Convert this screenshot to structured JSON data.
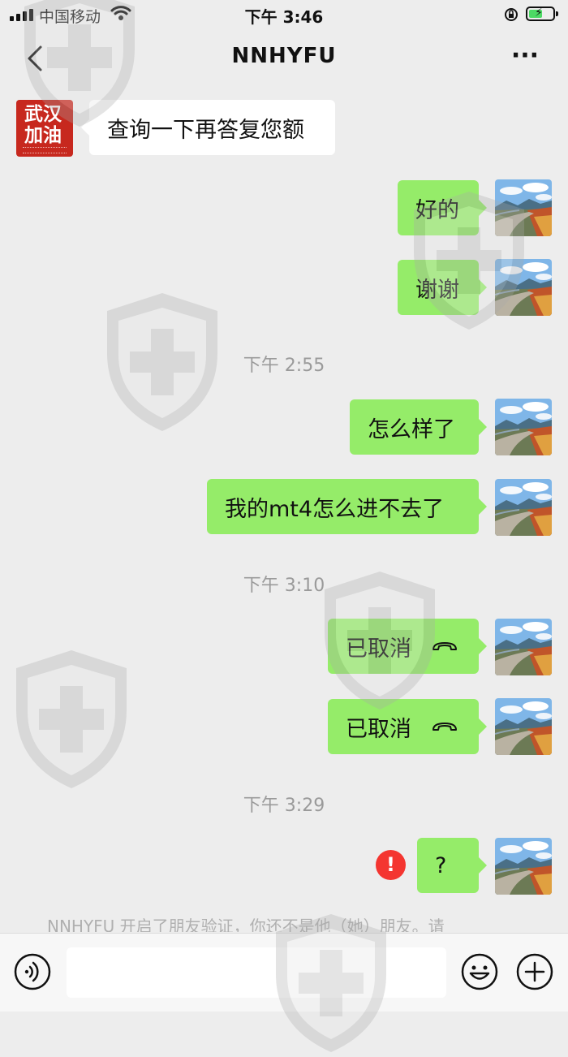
{
  "status_bar": {
    "carrier": "中国移动",
    "time": "下午 3:46",
    "battery_charging": true
  },
  "header": {
    "title": "NNHYFU",
    "back_icon": "chevron-left-icon",
    "more_label": "···"
  },
  "contact_avatar": {
    "line1": "武汉",
    "line2": "加油",
    "color": "#c7281e"
  },
  "messages": [
    {
      "side": "in",
      "text": "查询一下再答复您额"
    },
    {
      "side": "out",
      "text": "好的"
    },
    {
      "side": "out",
      "text": "谢谢"
    },
    {
      "type": "timestamp",
      "text": "下午 2:55"
    },
    {
      "side": "out",
      "text": "怎么样了"
    },
    {
      "side": "out",
      "text": "我的mt4怎么进不去了"
    },
    {
      "type": "timestamp",
      "text": "下午 3:10"
    },
    {
      "side": "out",
      "text": "已取消",
      "call_icon": "hang-up-icon"
    },
    {
      "side": "out",
      "text": "已取消",
      "call_icon": "hang-up-icon"
    },
    {
      "type": "timestamp",
      "text": "下午 3:29"
    },
    {
      "side": "out",
      "text": "?",
      "failed": true
    }
  ],
  "error_badge": "!",
  "system_message": "NNHYFU 开启了朋友验证，你还不是他（她）朋友。请",
  "input_bar": {
    "voice_icon": "voice-icon",
    "emoji_icon": "emoji-icon",
    "plus_icon": "plus-circle-icon"
  },
  "colors": {
    "background": "#ededed",
    "bubble_out": "#95ec69",
    "bubble_in": "#ffffff",
    "error": "#f43530",
    "timestamp_text": "#9a9a9a"
  }
}
